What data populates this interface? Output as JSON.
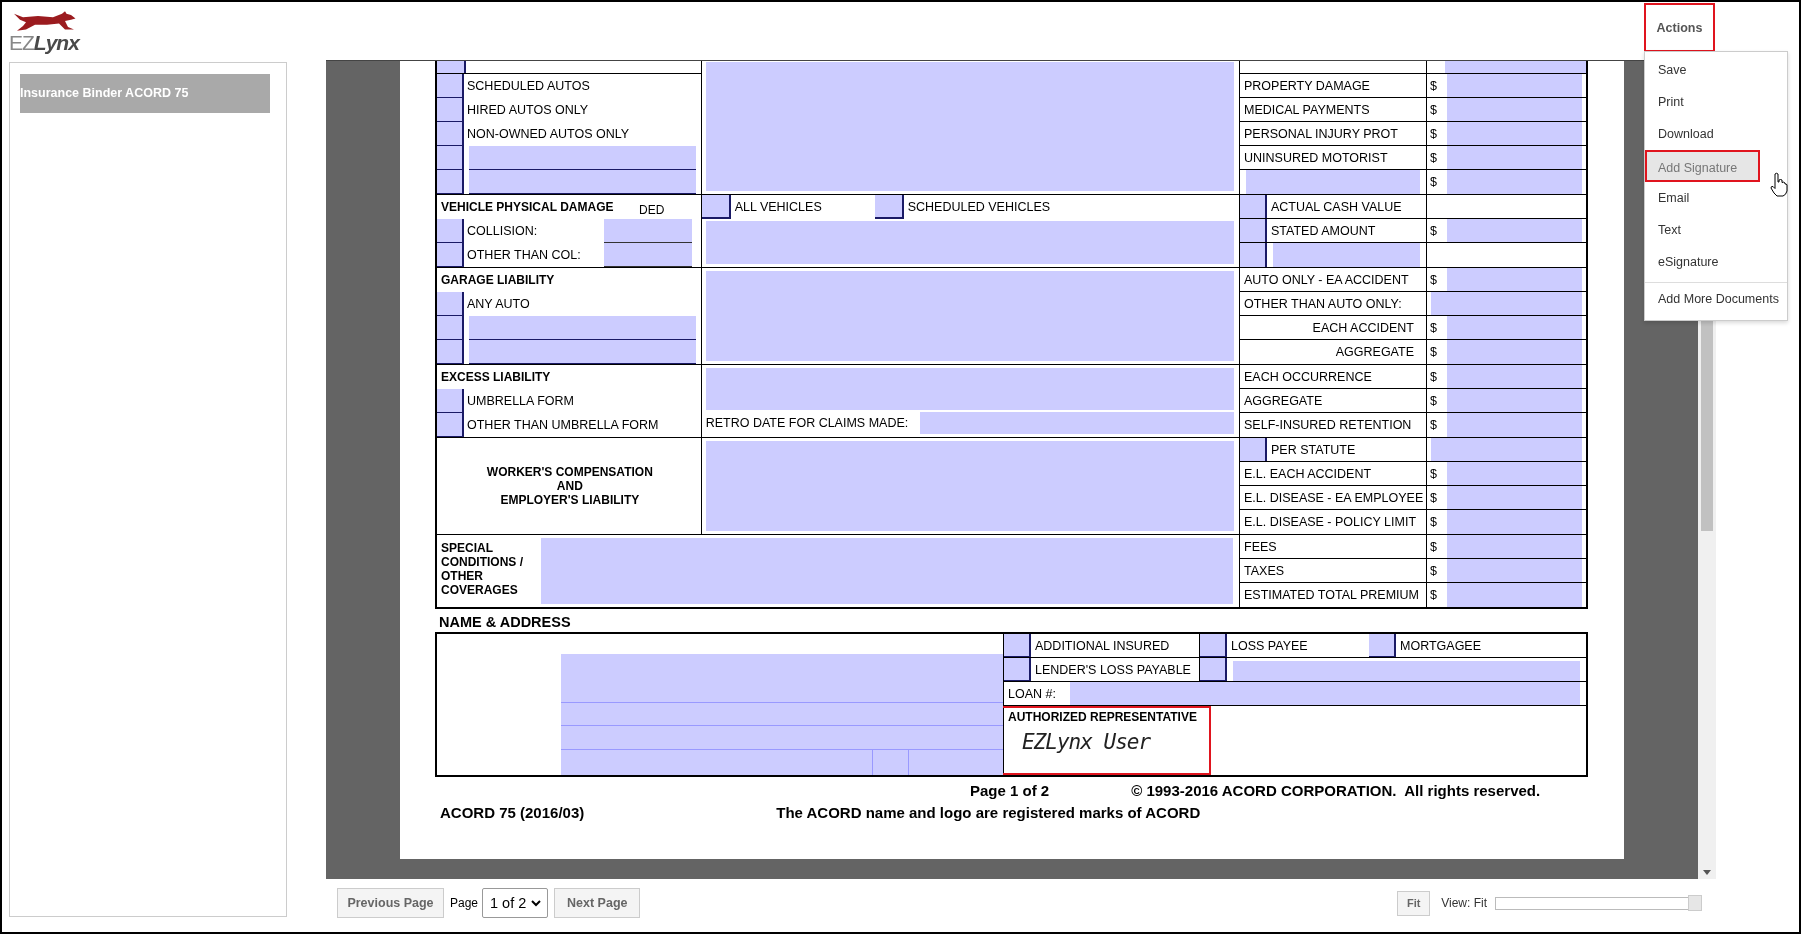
{
  "logo": {
    "prefix": "EZ",
    "name": "Lynx"
  },
  "actions": {
    "label": "Actions",
    "selected": true,
    "items": [
      {
        "label": "Save",
        "selected": false
      },
      {
        "label": "Print",
        "selected": false
      },
      {
        "label": "Download",
        "selected": false
      },
      {
        "label": "Add Signature",
        "selected": true
      },
      {
        "label": "Email",
        "selected": false
      },
      {
        "label": "Text",
        "selected": false
      },
      {
        "label": "eSignature",
        "selected": false
      }
    ],
    "extra_items": [
      {
        "label": "Add More Documents",
        "selected": false
      }
    ]
  },
  "sidebar": {
    "items": [
      {
        "label": "Insurance Binder ACORD 75",
        "selected": true
      }
    ]
  },
  "sections": [
    {
      "kind": "continued",
      "left": [
        {
          "kind": "check",
          "label": "SCHEDULED AUTOS",
          "checked": false
        },
        {
          "kind": "check",
          "label": "HIRED AUTOS ONLY",
          "checked": false
        },
        {
          "kind": "check",
          "label": "NON-OWNED AUTOS ONLY",
          "checked": false
        },
        {
          "kind": "line",
          "checked": false
        },
        {
          "kind": "line",
          "checked": false
        }
      ],
      "mid": {
        "kind": "field"
      },
      "right": [
        {
          "kind": "amount",
          "label": "PROPERTY DAMAGE",
          "currency": "$"
        },
        {
          "kind": "amount",
          "label": "MEDICAL PAYMENTS",
          "currency": "$"
        },
        {
          "kind": "amount",
          "label": "PERSONAL INJURY PROT",
          "currency": "$"
        },
        {
          "kind": "amount",
          "label": "UNINSURED MOTORIST",
          "currency": "$"
        },
        {
          "kind": "blank",
          "currency": "$"
        }
      ]
    },
    {
      "kind": "titled",
      "title": "VEHICLE PHYSICAL DAMAGE",
      "ded": "DED",
      "left": [
        {
          "kind": "ded",
          "label": "COLLISION:",
          "checked": false
        },
        {
          "kind": "ded",
          "label": "OTHER THAN COL:",
          "checked": false
        }
      ],
      "mid": {
        "kind": "vehicle",
        "options": [
          {
            "label": "ALL VEHICLES",
            "checked": false
          },
          {
            "label": "SCHEDULED VEHICLES",
            "checked": false
          }
        ]
      },
      "right": [
        {
          "kind": "option",
          "label": "ACTUAL CASH VALUE",
          "checked": false
        },
        {
          "kind": "option-amount",
          "label": "STATED AMOUNT",
          "checked": false,
          "currency": "$"
        },
        {
          "kind": "option-line",
          "checked": false
        }
      ]
    },
    {
      "kind": "titled",
      "title": "GARAGE LIABILITY",
      "left": [
        {
          "kind": "check",
          "label": "ANY AUTO",
          "checked": false
        },
        {
          "kind": "line",
          "checked": false
        },
        {
          "kind": "line",
          "checked": false
        }
      ],
      "mid": {
        "kind": "field"
      },
      "right": [
        {
          "kind": "amount",
          "label": "AUTO ONLY - EA ACCIDENT",
          "currency": "$"
        },
        {
          "kind": "open",
          "label": "OTHER THAN AUTO ONLY:"
        },
        {
          "kind": "sub",
          "label": "EACH ACCIDENT",
          "currency": "$"
        },
        {
          "kind": "sub",
          "label": "AGGREGATE",
          "currency": "$"
        }
      ]
    },
    {
      "kind": "titled",
      "title": "EXCESS LIABILITY",
      "left": [
        {
          "kind": "check",
          "label": "UMBRELLA FORM",
          "checked": false
        },
        {
          "kind": "check",
          "label": "OTHER THAN UMBRELLA FORM",
          "checked": false
        }
      ],
      "mid": {
        "kind": "retro",
        "label": "RETRO DATE FOR CLAIMS MADE:"
      },
      "right": [
        {
          "kind": "amount",
          "label": "EACH OCCURRENCE",
          "currency": "$"
        },
        {
          "kind": "amount",
          "label": "AGGREGATE",
          "currency": "$"
        },
        {
          "kind": "amount",
          "label": "SELF-INSURED RETENTION",
          "currency": "$"
        }
      ]
    },
    {
      "kind": "centered",
      "title": "WORKER'S COMPENSATION\nAND\nEMPLOYER'S LIABILITY",
      "mid": {
        "kind": "field"
      },
      "right": [
        {
          "kind": "option-open",
          "label": "PER STATUTE",
          "checked": false
        },
        {
          "kind": "amount",
          "label": "E.L. EACH ACCIDENT",
          "currency": "$"
        },
        {
          "kind": "amount",
          "label": "E.L. DISEASE - EA EMPLOYEE",
          "currency": "$"
        },
        {
          "kind": "amount",
          "label": "E.L. DISEASE - POLICY LIMIT",
          "currency": "$"
        }
      ]
    },
    {
      "kind": "special",
      "title": "SPECIAL CONDITIONS / OTHER COVERAGES",
      "mid": {
        "kind": "field"
      },
      "right": [
        {
          "kind": "amount",
          "label": "FEES",
          "currency": "$"
        },
        {
          "kind": "amount",
          "label": "TAXES",
          "currency": "$"
        },
        {
          "kind": "amount",
          "label": "ESTIMATED TOTAL PREMIUM",
          "currency": "$"
        }
      ]
    }
  ],
  "name_address": {
    "title": "NAME & ADDRESS",
    "options": [
      {
        "label": "ADDITIONAL INSURED",
        "checked": false
      },
      {
        "label": "LOSS PAYEE",
        "checked": false
      },
      {
        "label": "MORTGAGEE",
        "checked": false
      },
      {
        "label": "LENDER'S LOSS PAYABLE",
        "checked": false
      },
      {
        "checked": false
      }
    ],
    "loan_label": "LOAN #:",
    "rep_label": "AUTHORIZED REPRESENTATIVE",
    "signature": "EZLynx User",
    "rep_highlighted": true
  },
  "footer": {
    "page": "Page 1 of 2",
    "copyright": "© 1993-2016 ACORD CORPORATION.  All rights reserved.",
    "form_id": "ACORD 75 (2016/03)",
    "marks": "The ACORD name and logo are registered marks of ACORD"
  },
  "pager": {
    "previous": "Previous Page",
    "page_label": "Page",
    "page_value": "1 of 2",
    "next": "Next Page"
  },
  "view": {
    "fit": "Fit",
    "label": "View: Fit",
    "level": 1
  }
}
